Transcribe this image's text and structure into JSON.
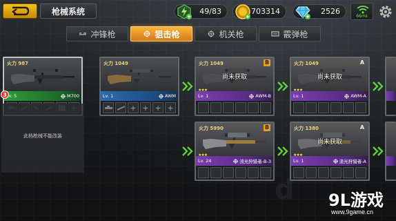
{
  "header": {
    "title": "枪械系统",
    "resources": [
      {
        "name": "energy",
        "value": "49/83",
        "icon": "energy-plus-icon",
        "color": "#5fc24a"
      },
      {
        "name": "gold",
        "value": "703314",
        "icon": "gold-coin-icon",
        "color": "#f3c324"
      },
      {
        "name": "diamond",
        "value": "2526",
        "icon": "diamond-icon",
        "color": "#6fd0ff"
      }
    ],
    "ping": "66ms"
  },
  "tabs": [
    {
      "label": "冲锋枪",
      "icon": "smg-icon",
      "active": false
    },
    {
      "label": "狙击枪",
      "icon": "crosshair-icon",
      "active": true
    },
    {
      "label": "机关枪",
      "icon": "crosshair-icon",
      "active": false
    },
    {
      "label": "霰弹枪",
      "icon": "shotgun-icon",
      "active": false
    }
  ],
  "weapons": [
    {
      "id": "m700",
      "firepower": "火力 987",
      "level": "Lv. 5",
      "name": "M700",
      "rarity": "green",
      "grade": "",
      "locked": false
    },
    {
      "id": "awm",
      "firepower": "火力 1049",
      "level": "Lv. 1",
      "name": "AWM",
      "rarity": "blue",
      "grade": "",
      "locked": false
    },
    {
      "id": "awm-b",
      "firepower": "火力 1049",
      "level": "Lv. 1",
      "name": "AWM-B",
      "rarity": "purple",
      "grade": "B",
      "locked": true
    },
    {
      "id": "awm-a",
      "firepower": "火力 1049",
      "level": "Lv. 1",
      "name": "AWM-A",
      "rarity": "purple",
      "grade": "A",
      "locked": true
    },
    {
      "id": "hunter-b3",
      "firepower": "火力 5990",
      "level": "Lv. 24",
      "name": "流光狩猎者-B-3",
      "rarity": "purple",
      "grade": "B",
      "locked": false
    },
    {
      "id": "hunter-a",
      "firepower": "火力 1380",
      "level": "Lv. 1",
      "name": "流光狩猎者-A",
      "rarity": "purple",
      "grade": "A",
      "locked": true
    }
  ],
  "locked_label": "尚未获取",
  "notification_count": "3",
  "no_change_text": "此档枪械不能改装",
  "watermark": {
    "logo": "9L游戏",
    "url": "www.9game.cn"
  }
}
